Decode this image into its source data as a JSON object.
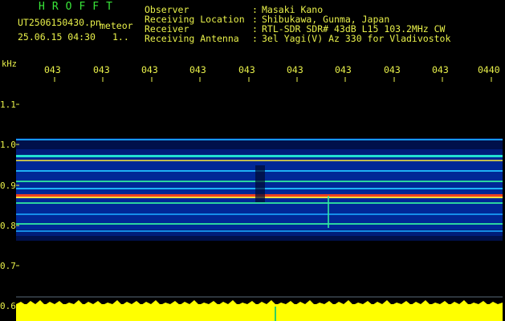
{
  "header": {
    "title": "HROFFT",
    "file_name": "UT2506150430.pn",
    "file_suffix": "meteor",
    "date_time": "25.06.15 04:30",
    "page": "1.."
  },
  "info": [
    {
      "label": "Observer",
      "value": "Masaki Kano"
    },
    {
      "label": "Receiving Location",
      "value": "Shibukawa, Gunma, Japan"
    },
    {
      "label": "Receiver",
      "value": "RTL-SDR SDR# 43dB L15 103.2MHz CW"
    },
    {
      "label": "Receiving Antenna",
      "value": "3el Yagi(V) Az 330 for Vladivostok"
    }
  ],
  "axis": {
    "unit": "kHz",
    "time_labels": [
      "043",
      "043",
      "043",
      "043",
      "043",
      "043",
      "043",
      "043",
      "043",
      "0440"
    ],
    "freq_labels": [
      "1.1",
      "1.0",
      "0.9",
      "0.8",
      "0.7",
      "0.6"
    ]
  },
  "colors": {
    "text": "#e8f04a",
    "title": "#39e639",
    "background": "#000000",
    "baseline": "#ffff00"
  }
}
